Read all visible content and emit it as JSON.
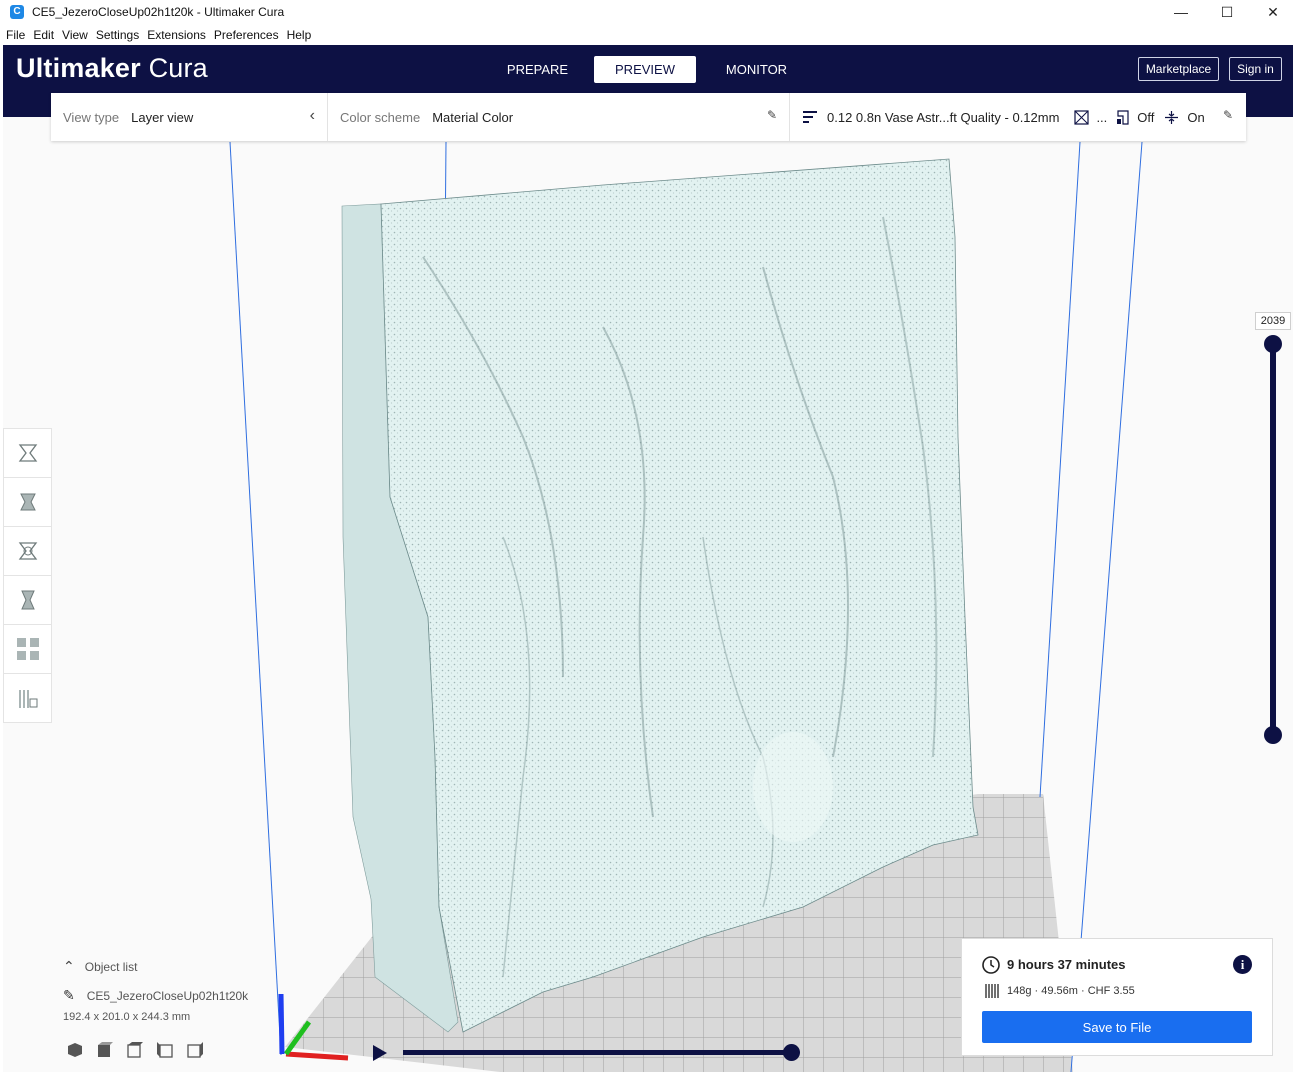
{
  "window": {
    "title": "CE5_JezeroCloseUp02h1t20k - Ultimaker Cura",
    "app_icon": "C",
    "controls": [
      "—",
      "☐",
      "✕"
    ]
  },
  "menu": [
    "File",
    "Edit",
    "View",
    "Settings",
    "Extensions",
    "Preferences",
    "Help"
  ],
  "header": {
    "logo_bold": "Ultimaker",
    "logo_light": "Cura",
    "tabs": [
      {
        "label": "PREPARE"
      },
      {
        "label": "PREVIEW"
      },
      {
        "label": "MONITOR"
      }
    ],
    "active_tab": "PREVIEW",
    "marketplace": "Marketplace",
    "sign_in": "Sign in"
  },
  "viewbar": {
    "view_type_label": "View type",
    "view_type_value": "Layer view",
    "color_scheme_label": "Color scheme",
    "color_scheme_value": "Material Color",
    "profile": "0.12 0.8n Vase Astr...ft Quality - 0.12mm",
    "ellipsis": "...",
    "support": "Off",
    "adhesion": "On"
  },
  "layer_slider": {
    "value": "2039"
  },
  "object_list": {
    "toggle_label": "Object list",
    "object_name": "CE5_JezeroCloseUp02h1t20k",
    "dimensions": "192.4 x 201.0 x 244.3 mm"
  },
  "print_info": {
    "time": "9 hours 37 minutes",
    "materials": "148g · 49.56m · CHF 3.55",
    "save_label": "Save to File",
    "info_icon": "i"
  },
  "colors": {
    "header_bg": "#0d1144",
    "accent_blue": "#196ef0",
    "model_fill": "#dcefee",
    "grid": "#8c8c8c"
  },
  "icons": {
    "tools": [
      "move-icon",
      "scale-icon",
      "rotate-icon",
      "mirror-icon",
      "per-model-settings-icon",
      "support-blocker-icon"
    ],
    "camera_views": [
      "3d-view-icon",
      "front-view-icon",
      "top-view-icon",
      "left-view-icon",
      "right-view-icon"
    ]
  }
}
